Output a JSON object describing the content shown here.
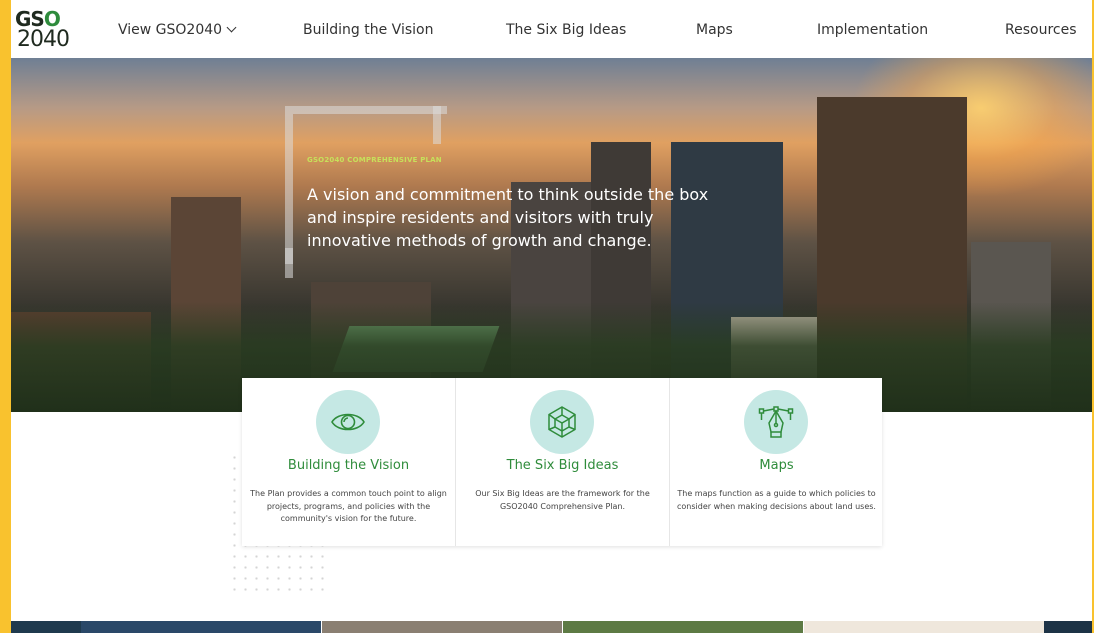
{
  "nav": {
    "logo_top": "GS",
    "logo_o": "O",
    "logo_bottom": "2040",
    "items": [
      {
        "label": "View GSO2040"
      },
      {
        "label": "Building the Vision"
      },
      {
        "label": "The Six Big Ideas"
      },
      {
        "label": "Maps"
      },
      {
        "label": "Implementation"
      },
      {
        "label": "Resources"
      }
    ]
  },
  "hero": {
    "kicker": "GSO2040 COMPREHENSIVE PLAN",
    "heading": "A vision and commitment to think outside the box and inspire residents and visitors with truly innovative methods of growth and change."
  },
  "cards": [
    {
      "icon": "eye-icon",
      "title": "Building the Vision",
      "description": "The Plan provides a common touch point to align projects, programs, and policies with the community's vision for the future."
    },
    {
      "icon": "cube-icon",
      "title": "The Six Big Ideas",
      "description": "Our Six Big Ideas are the framework for the GSO2040 Comprehensive Plan."
    },
    {
      "icon": "pen-tool-icon",
      "title": "Maps",
      "description": "The maps function as a guide to which policies to consider when making decisions about land uses."
    }
  ],
  "colors": {
    "accent_green": "#2f8c3b",
    "kicker_lime": "#c7e05a",
    "icon_circle": "#c5e8e4",
    "border_yellow": "#f9c22e"
  }
}
